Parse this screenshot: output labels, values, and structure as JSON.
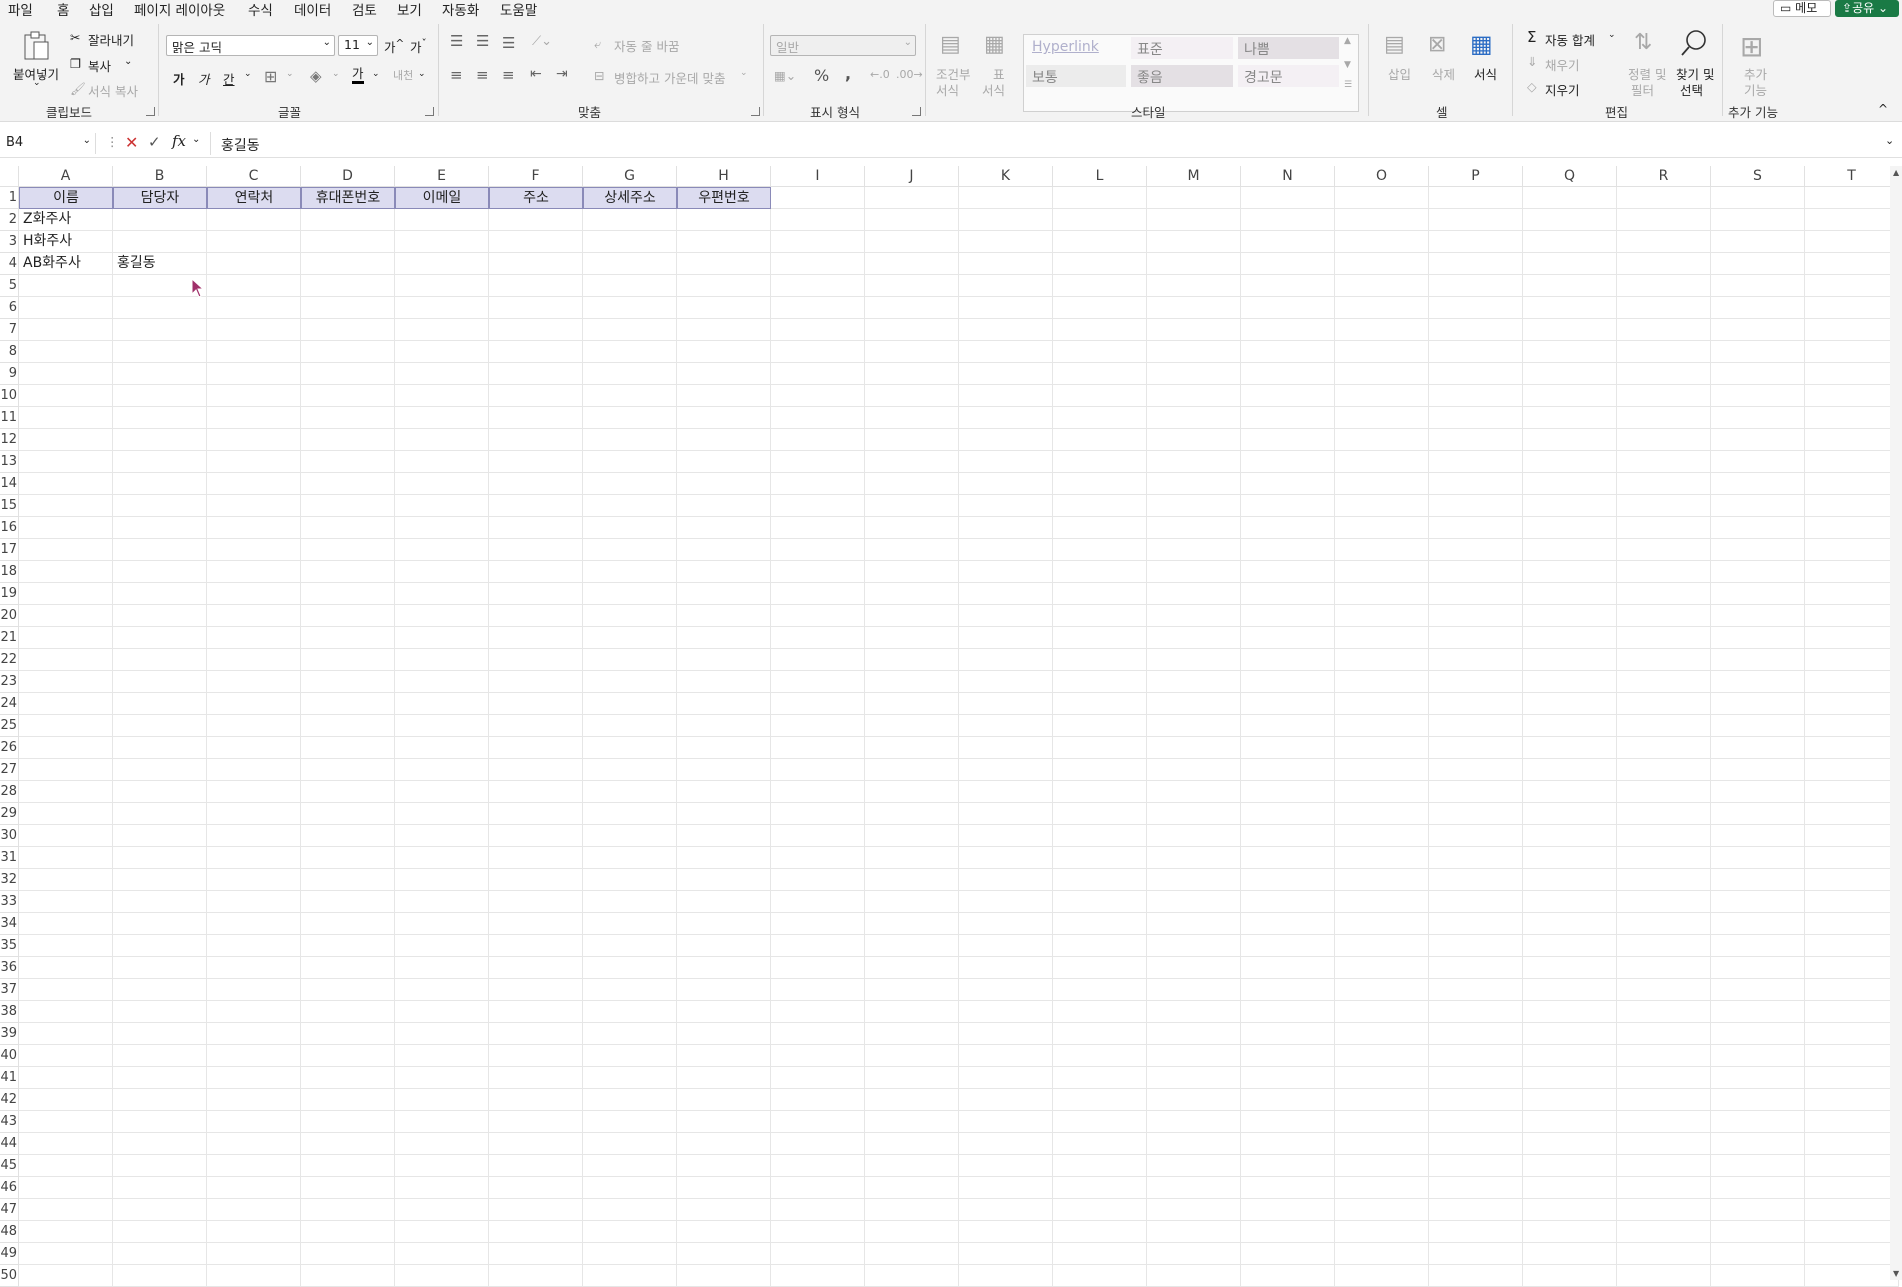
{
  "menu": {
    "tabs": [
      "파일",
      "홈",
      "삽입",
      "페이지 레이아웃",
      "수식",
      "데이터",
      "검토",
      "보기",
      "자동화",
      "도움말"
    ],
    "memo": "메모",
    "share": "공유"
  },
  "ribbon": {
    "clipboard": {
      "paste": "붙여넣기",
      "cut": "잘라내기",
      "copy": "복사",
      "format_painter": "서식 복사",
      "group": "클립보드"
    },
    "font": {
      "name": "맑은 고딕",
      "size": "11",
      "group": "글꼴",
      "bold": "가",
      "italic": "가",
      "underline": "간",
      "fontcolor": "가",
      "phonetic": "내천"
    },
    "alignment": {
      "wrap": "자동 줄 바꿈",
      "merge": "병합하고 가운데 맞춤",
      "group": "맞춤"
    },
    "number": {
      "format": "일반",
      "percent": "%",
      "comma": ",",
      "group": "표시 형식"
    },
    "styles": {
      "cond": "조건부",
      "cond2": "서식",
      "table": "표",
      "table2": "서식",
      "items": [
        "Hyperlink",
        "표준",
        "나쁨",
        "보통",
        "좋음",
        "경고문"
      ],
      "group": "스타일"
    },
    "cells": {
      "insert": "삽입",
      "delete": "삭제",
      "format": "서식",
      "group": "셀"
    },
    "editing": {
      "autosum": "자동 합계",
      "fill": "채우기",
      "clear": "지우기",
      "sort": "정렬 및",
      "sort2": "필터",
      "find": "찾기 및",
      "find2": "선택",
      "group": "편집"
    },
    "addins": {
      "label": "추가",
      "label2": "기능",
      "group": "추가 기능"
    }
  },
  "formula_bar": {
    "name_box": "B4",
    "fx": "fx",
    "content": "홍길동"
  },
  "columns": [
    "A",
    "B",
    "C",
    "D",
    "E",
    "F",
    "G",
    "H",
    "I",
    "J",
    "K",
    "L",
    "M",
    "N",
    "O",
    "P",
    "Q",
    "R",
    "S",
    "T"
  ],
  "header_row": [
    "이름",
    "담당자",
    "연락처",
    "휴대폰번호",
    "이메일",
    "주소",
    "상세주소",
    "우편번호"
  ],
  "rows": [
    [
      "Z화주사",
      ""
    ],
    [
      "H화주사",
      ""
    ],
    [
      "AB화주사",
      "홍길동"
    ]
  ],
  "row_numbers": [
    "1",
    "2",
    "3",
    "4",
    "5",
    "6",
    "7",
    "8",
    "9",
    "10",
    "11",
    "12",
    "13",
    "14",
    "15",
    "16",
    "17",
    "18",
    "19",
    "20",
    "21",
    "22",
    "23",
    "24",
    "25",
    "26",
    "27",
    "28",
    "29",
    "30",
    "31",
    "32",
    "33",
    "34",
    "35",
    "36",
    "37",
    "38",
    "39",
    "40",
    "41",
    "42",
    "43",
    "44",
    "45",
    "46",
    "47",
    "48",
    "49",
    "50"
  ]
}
